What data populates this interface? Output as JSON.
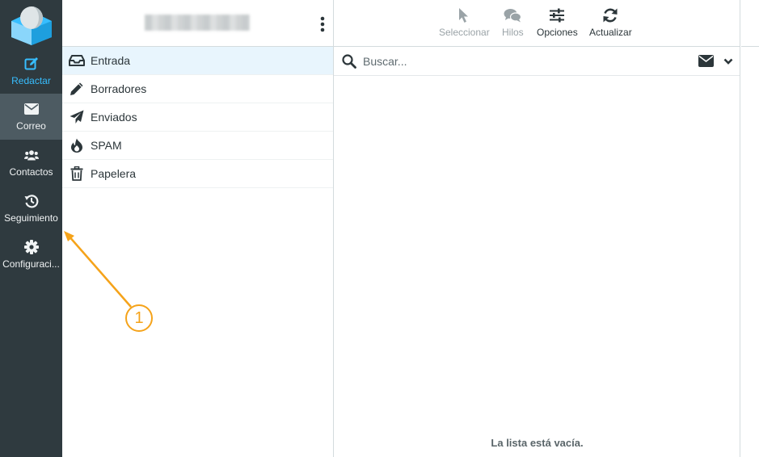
{
  "sidebar": {
    "items": [
      {
        "key": "compose",
        "label": "Redactar",
        "icon": "compose-icon"
      },
      {
        "key": "mail",
        "label": "Correo",
        "icon": "envelope-icon"
      },
      {
        "key": "contacts",
        "label": "Contactos",
        "icon": "users-icon"
      },
      {
        "key": "tracking",
        "label": "Seguimiento",
        "icon": "history-icon"
      },
      {
        "key": "settings",
        "label": "Configuraci...",
        "icon": "gear-icon"
      }
    ],
    "active": "mail"
  },
  "folders": {
    "items": [
      {
        "label": "Entrada",
        "icon": "inbox-icon"
      },
      {
        "label": "Borradores",
        "icon": "pencil-icon"
      },
      {
        "label": "Enviados",
        "icon": "paper-plane-icon"
      },
      {
        "label": "SPAM",
        "icon": "fire-icon"
      },
      {
        "label": "Papelera",
        "icon": "trash-icon"
      }
    ],
    "selected": "Entrada"
  },
  "toolbar": {
    "select_label": "Seleccionar",
    "threads_label": "Hilos",
    "options_label": "Opciones",
    "refresh_label": "Actualizar"
  },
  "search": {
    "placeholder": "Buscar..."
  },
  "list": {
    "empty_message": "La lista está vacía."
  },
  "annotation": {
    "number": "1"
  },
  "colors": {
    "sidebar_bg": "#2f3a3f",
    "sidebar_active": "#4d5b62",
    "accent": "#37beff",
    "annotation": "#f5a31a",
    "selected_folder_bg": "#e8f5fd"
  }
}
